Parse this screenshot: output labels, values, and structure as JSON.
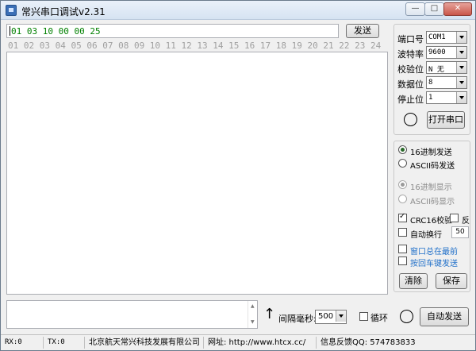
{
  "window": {
    "title": "常兴串口调试v2.31",
    "min_glyph": "—",
    "max_glyph": "□",
    "close_glyph": "✕"
  },
  "send": {
    "hex_text": "01 03 10 00 00 25",
    "send_label": "发送"
  },
  "ruler": "01 02 03 04 05 06 07 08 09 10 11 12 13 14 15 16 17 18 19 20 21 22 23 24",
  "settings": {
    "port_label": "端口号",
    "port_value": "COM1",
    "baud_label": "波特率",
    "baud_value": "9600",
    "parity_label": "校验位",
    "parity_value": "N 无",
    "databits_label": "数据位",
    "databits_value": "8",
    "stopbits_label": "停止位",
    "stopbits_value": "1",
    "open_label": "打开串口"
  },
  "options": {
    "hex_send": "16进制发送",
    "ascii_send": "ASCII码发送",
    "hex_show": "16进制显示",
    "ascii_show": "ASCII码显示",
    "crc": "CRC16校验",
    "reverse": "反",
    "auto_newline": "自动换行",
    "newline_value": "50",
    "on_top": "窗口总在最前",
    "enter_send": "按回车键发送",
    "clear_label": "清除",
    "save_label": "保存"
  },
  "bottom": {
    "interval_label": "间隔毫秒:",
    "interval_value": "500",
    "cycle_label": "循环",
    "auto_send_label": "自动发送"
  },
  "status": {
    "rx": "RX:0",
    "tx": "TX:0",
    "company": "北京航天常兴科技发展有限公司",
    "website": "网址: http://www.htcx.cc/",
    "qq": "信息反馈QQ: 574783833"
  }
}
